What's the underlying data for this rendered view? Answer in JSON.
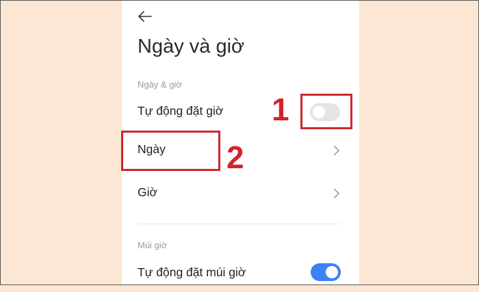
{
  "page": {
    "title": "Ngày và giờ",
    "section_date_time": "Ngày & giờ",
    "section_timezone": "Múi giờ"
  },
  "rows": {
    "auto_time": {
      "label": "Tự động đặt giờ",
      "toggle_on": false
    },
    "date": {
      "label": "Ngày"
    },
    "time": {
      "label": "Giờ"
    },
    "auto_timezone": {
      "label": "Tự động đặt múi giờ",
      "toggle_on": true
    }
  },
  "annotations": {
    "step1": "1",
    "step2": "2",
    "color": "#d0262a"
  },
  "colors": {
    "background": "#fbe7d3",
    "toggle_on": "#3b82f6",
    "toggle_off": "#e4e4e4"
  },
  "icons": [
    "back-arrow-icon",
    "chevron-right-icon"
  ]
}
